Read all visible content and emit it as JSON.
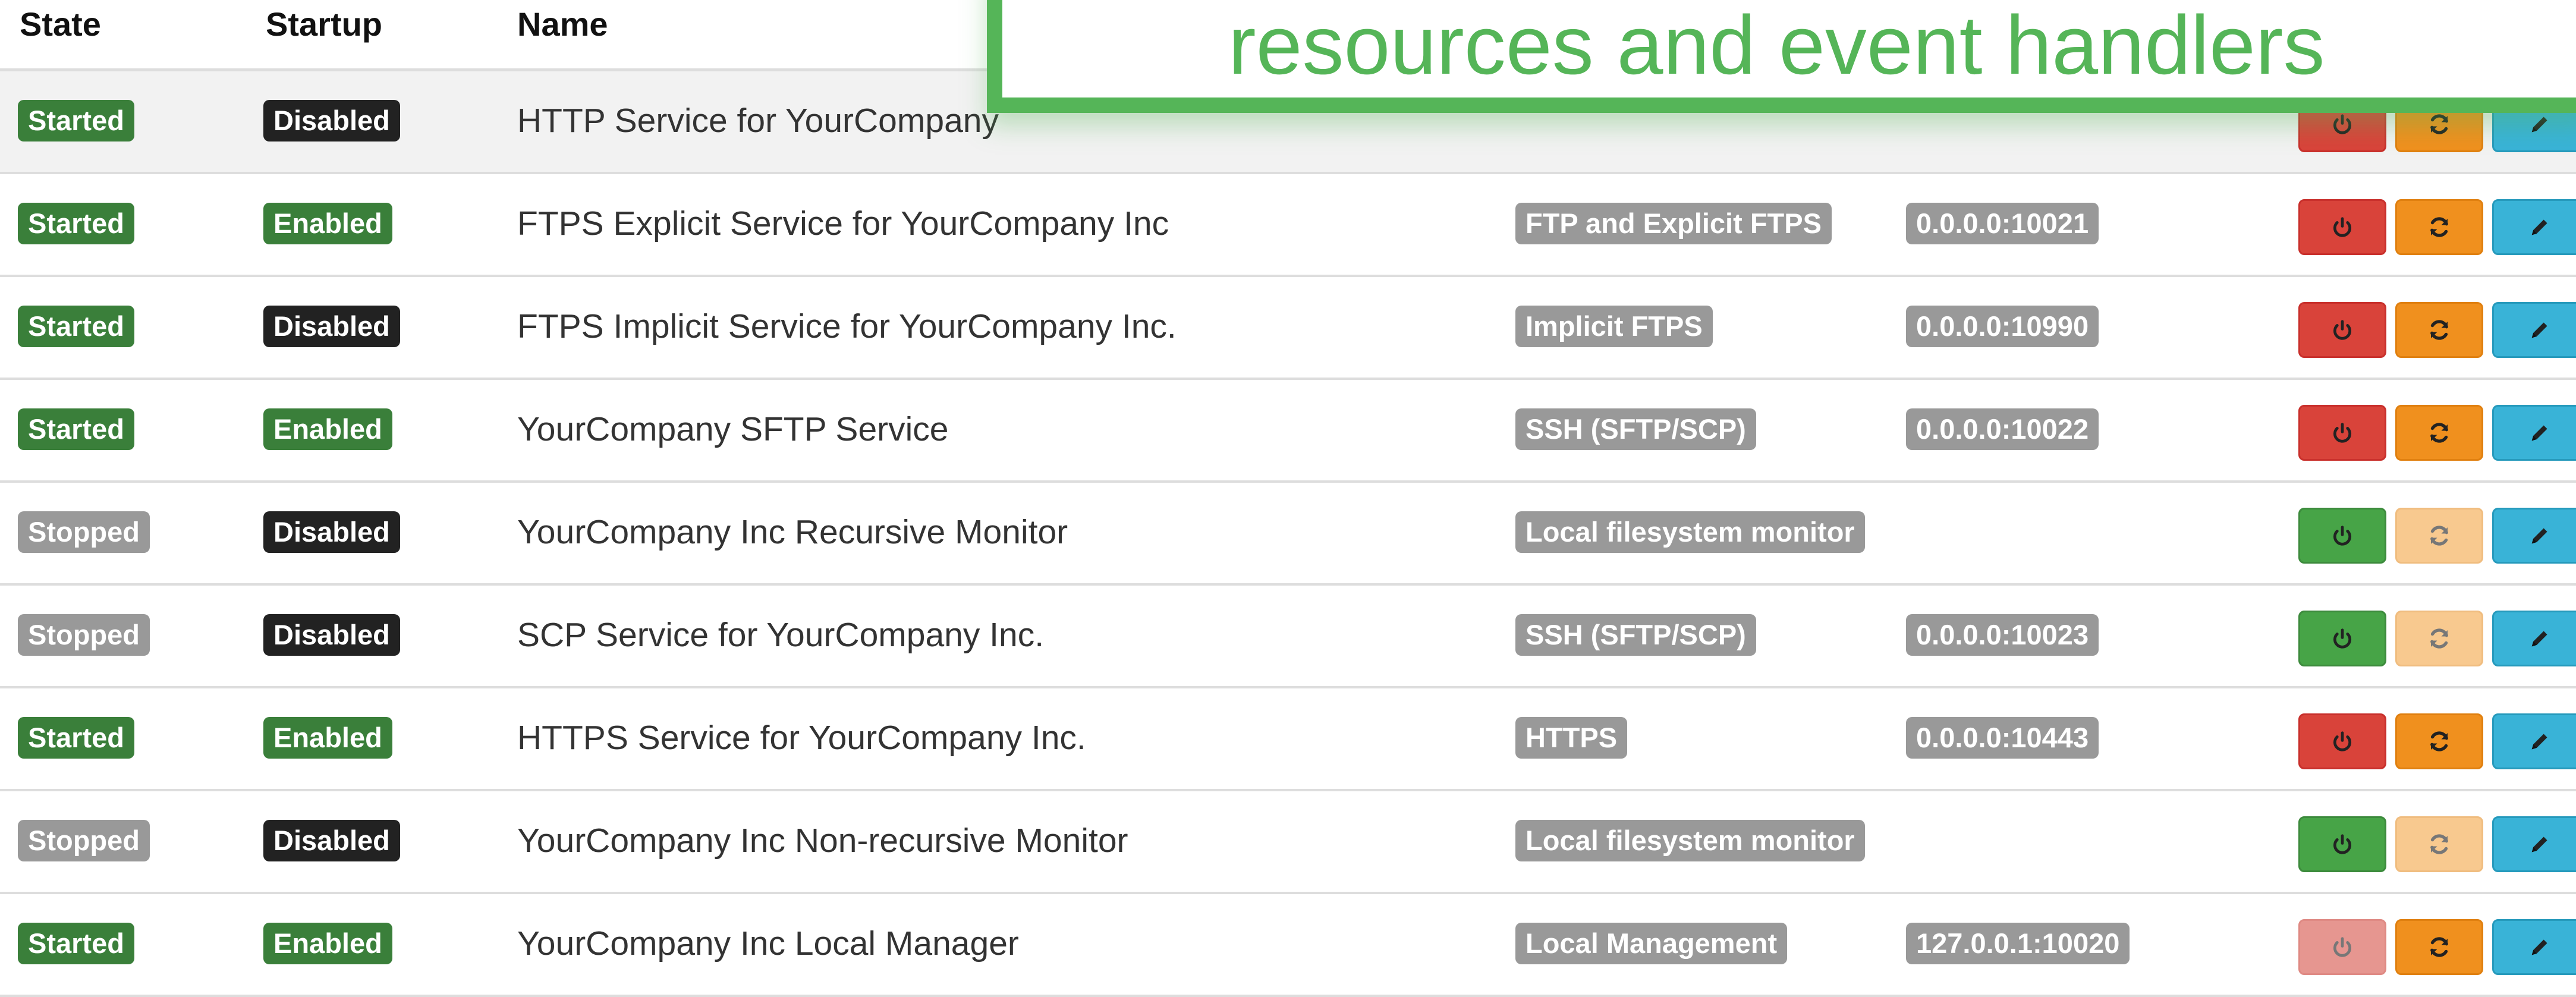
{
  "header": {
    "state": "State",
    "startup": "Startup",
    "name": "Name"
  },
  "overlay": {
    "text": "resources and event handlers"
  },
  "colors": {
    "started": "#3a7f3a",
    "stopped": "#999999",
    "disabled": "#222222",
    "stop_button": "#d9433a",
    "start_button": "#47a447",
    "restart_button": "#f0901e",
    "edit_button": "#39b3d7",
    "callout": "#55b558"
  },
  "icons": {
    "power": "power-icon",
    "restart": "refresh-icon",
    "edit": "pencil-icon"
  },
  "rows": [
    {
      "state": "Started",
      "startup": "Disabled",
      "name": "HTTP Service for YourCompany",
      "type": "",
      "address": ""
    },
    {
      "state": "Started",
      "startup": "Enabled",
      "name": "FTPS Explicit Service for YourCompany Inc",
      "type": "FTP and Explicit FTPS",
      "address": "0.0.0.0:10021"
    },
    {
      "state": "Started",
      "startup": "Disabled",
      "name": "FTPS Implicit Service for YourCompany Inc.",
      "type": "Implicit FTPS",
      "address": "0.0.0.0:10990"
    },
    {
      "state": "Started",
      "startup": "Enabled",
      "name": "YourCompany SFTP Service",
      "type": "SSH (SFTP/SCP)",
      "address": "0.0.0.0:10022"
    },
    {
      "state": "Stopped",
      "startup": "Disabled",
      "name": "YourCompany Inc Recursive Monitor",
      "type": "Local filesystem monitor",
      "address": ""
    },
    {
      "state": "Stopped",
      "startup": "Disabled",
      "name": "SCP Service for YourCompany Inc.",
      "type": "SSH (SFTP/SCP)",
      "address": "0.0.0.0:10023"
    },
    {
      "state": "Started",
      "startup": "Enabled",
      "name": "HTTPS Service for YourCompany Inc.",
      "type": "HTTPS",
      "address": "0.0.0.0:10443"
    },
    {
      "state": "Stopped",
      "startup": "Disabled",
      "name": "YourCompany Inc Non-recursive Monitor",
      "type": "Local filesystem monitor",
      "address": ""
    },
    {
      "state": "Started",
      "startup": "Enabled",
      "name": "YourCompany Inc Local Manager",
      "type": "Local Management",
      "address": "127.0.0.1:10020"
    }
  ]
}
